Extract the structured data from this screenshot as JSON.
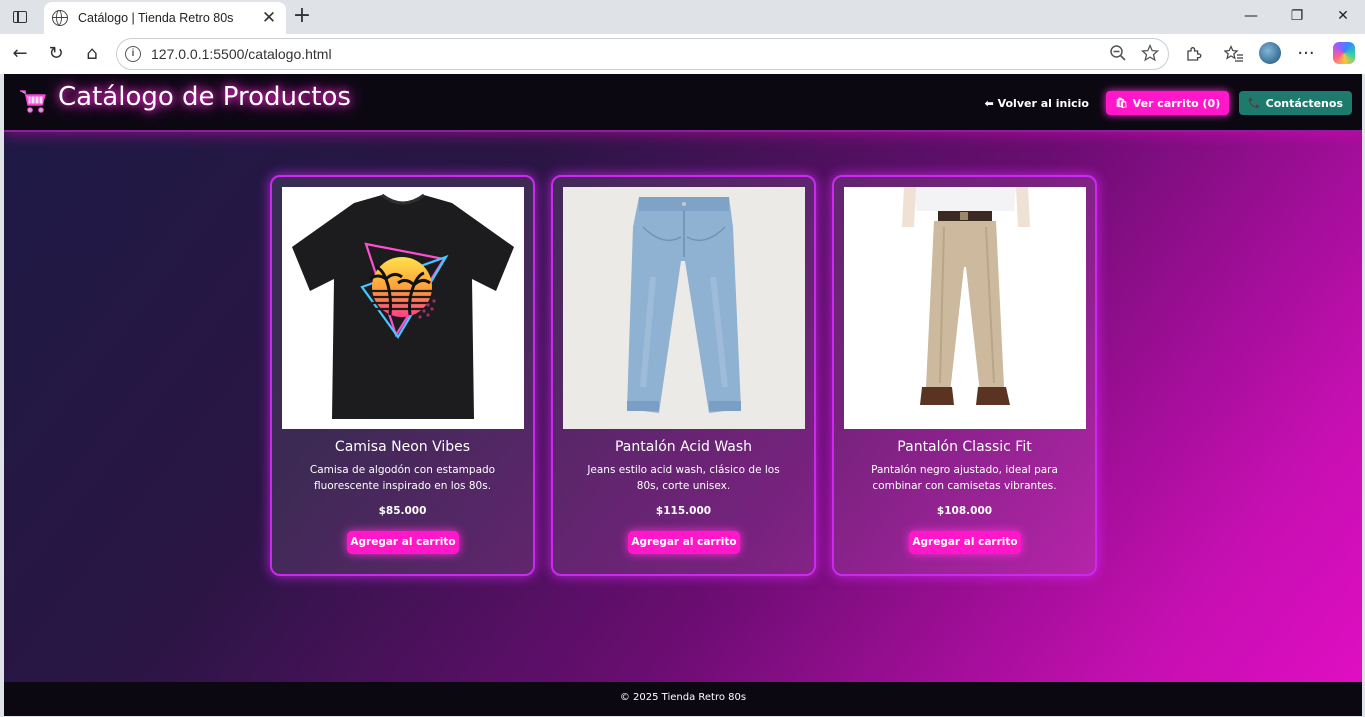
{
  "browser": {
    "tab_title": "Catálogo | Tienda Retro 80s",
    "tab_close": "✕",
    "new_tab": "+",
    "url": "127.0.0.1:5500/catalogo.html",
    "window_controls": {
      "minimize": "—",
      "restore": "❐",
      "close": "✕"
    },
    "nav": {
      "back": "←",
      "reload": "↻",
      "home": "⌂"
    },
    "icons": [
      "zoom-out-icon",
      "favorite-star-icon",
      "extensions-icon",
      "favorites-icon",
      "profile-avatar",
      "more-icon",
      "copilot-icon"
    ]
  },
  "header": {
    "title": "Catálogo de Productos",
    "home_link": "⬅ Volver al inicio",
    "cart_button": "Ver carrito (0)",
    "cart_icon": "🛍",
    "contact_button": "Contáctenos",
    "contact_icon": "📞",
    "accent": "#ff17c9",
    "contact_color": "#1e7a6d"
  },
  "products": [
    {
      "name": "Camisa Neon Vibes",
      "description": "Camisa de algodón con estampado fluorescente inspirado en los 80s.",
      "price": "$85.000",
      "button": "Agregar al carrito"
    },
    {
      "name": "Pantalón Acid Wash",
      "description": "Jeans estilo acid wash, clásico de los 80s, corte unisex.",
      "price": "$115.000",
      "button": "Agregar al carrito"
    },
    {
      "name": "Pantalón Classic Fit",
      "description": "Pantalón negro ajustado, ideal para combinar con camisetas vibrantes.",
      "price": "$108.000",
      "button": "Agregar al carrito"
    }
  ],
  "footer": {
    "text": "© 2025 Tienda Retro 80s"
  }
}
